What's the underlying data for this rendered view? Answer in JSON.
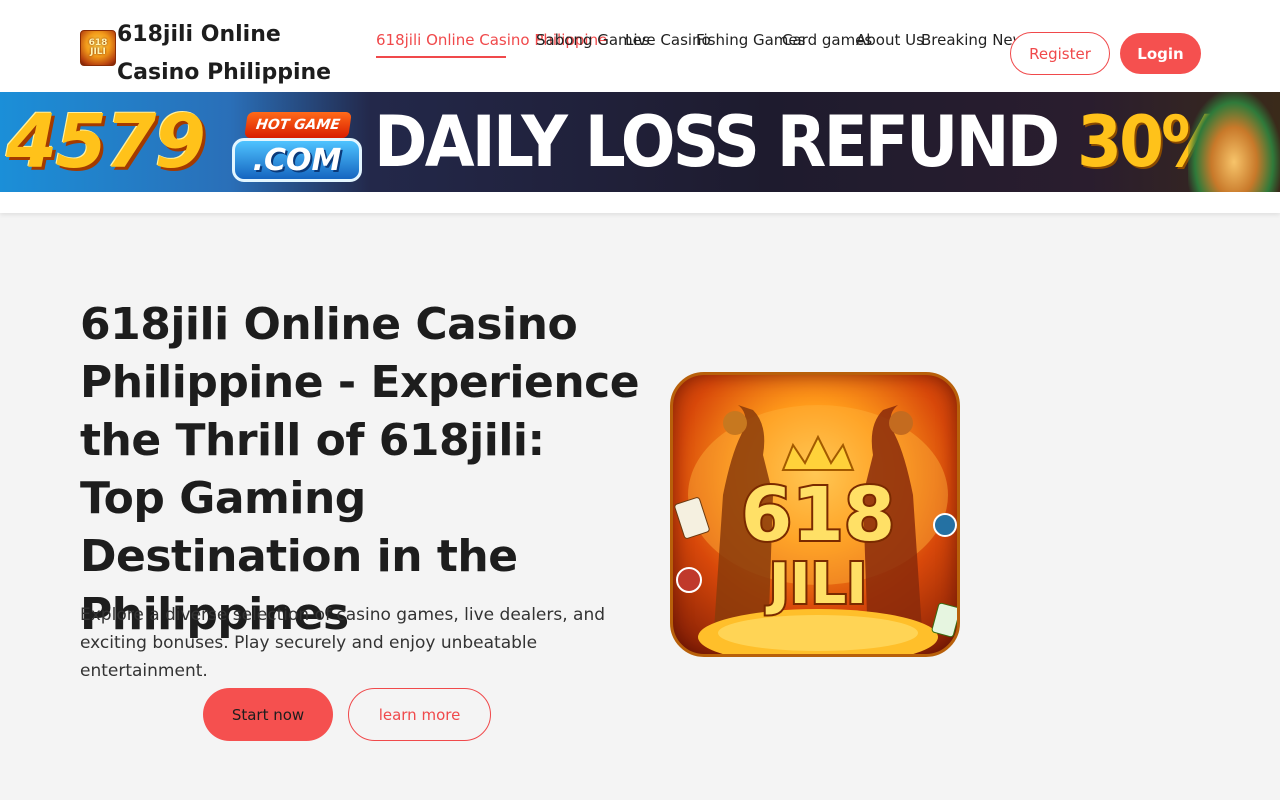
{
  "header": {
    "brand_title": "618jili Online Casino Philippine",
    "logo_text": "618 JILI",
    "nav": [
      {
        "label": "618jili Online Casino Philippine",
        "active": true
      },
      {
        "label": "Sabong Games",
        "active": false
      },
      {
        "label": "Live Casino",
        "active": false
      },
      {
        "label": "Fishing Games",
        "active": false
      },
      {
        "label": "Card games",
        "active": false
      },
      {
        "label": "About Us",
        "active": false
      },
      {
        "label": "Breaking News",
        "active": false
      }
    ],
    "register_label": "Register",
    "login_label": "Login"
  },
  "banner": {
    "site_number": "4579",
    "hot_game": "HOT GAME",
    "dot_com": ".COM",
    "headline": "DAILY LOSS REFUND",
    "percent": "30%"
  },
  "hero": {
    "title": "618jili Online Casino Philippine - Experience the Thrill of 618jili: Top Gaming Destination in the Philippines",
    "description": "Explore a diverse selection of casino games, live dealers, and exciting bonuses. Play securely and enjoy unbeatable entertainment.",
    "start_label": "Start now",
    "learn_label": "learn more",
    "icon_text_top": "618",
    "icon_text_bottom": "JILI"
  },
  "colors": {
    "accent": "#f0494b",
    "background": "#f4f4f4",
    "header_bg": "#ffffff"
  }
}
